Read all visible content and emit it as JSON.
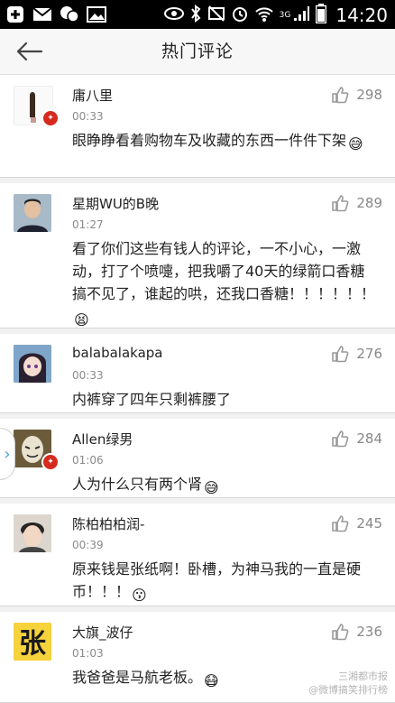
{
  "status_bar": {
    "time": "14:20",
    "network": "3G",
    "left_icons": [
      "add-icon",
      "mail-icon",
      "chat-icon",
      "image-icon"
    ],
    "right_icons": [
      "eye-icon",
      "bluetooth-icon",
      "mute-icon",
      "alarm-icon",
      "wifi-icon",
      "signal-icon",
      "battery-icon"
    ]
  },
  "app_bar": {
    "title": "热门评论",
    "back_icon": "arrow-left-icon"
  },
  "comments": [
    {
      "name": "庸八里",
      "time": "00:33",
      "likes": "298",
      "text": "眼睁睁看着购物车及收藏的东西一件件下架",
      "emoji": "😅",
      "verified": true
    },
    {
      "name": "星期WU的B晚",
      "time": "01:27",
      "likes": "289",
      "text": "看了你们这些有钱人的评论，一不小心，一激动，打了个喷嚏，把我嚼了40天的绿箭口香糖搞不见了，谁起的哄，还我口香糖！！！！！！",
      "emoji": "😫",
      "verified": false
    },
    {
      "name": "balabalakapa",
      "time": "00:33",
      "likes": "276",
      "text": "内裤穿了四年只剩裤腰了",
      "emoji": "",
      "verified": false
    },
    {
      "name": "Allen绿男",
      "time": "01:06",
      "likes": "284",
      "text": "人为什么只有两个肾",
      "emoji": "😅",
      "verified": true
    },
    {
      "name": "陈柏柏柏润-",
      "time": "00:39",
      "likes": "245",
      "text": "原来钱是张纸啊！卧槽，为神马我的一直是硬币！！！",
      "emoji": "😗",
      "verified": false
    },
    {
      "name": "大旗_波仔",
      "time": "01:03",
      "likes": "236",
      "text": "我爸爸是马航老板。",
      "emoji": "😷",
      "verified": false
    }
  ],
  "watermark": {
    "line1": "三湘都市报",
    "line2": "@微博搞笑排行榜"
  },
  "colors": {
    "accent_badge": "#d52a1d",
    "like_icon": "#999999",
    "text": "#222222",
    "meta": "#8a8a8a"
  }
}
